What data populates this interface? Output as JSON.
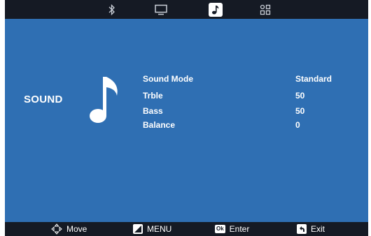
{
  "tabs": [
    {
      "icon": "bluetooth-icon",
      "active": false
    },
    {
      "icon": "monitor-icon",
      "active": false
    },
    {
      "icon": "music-note-icon",
      "active": true
    },
    {
      "icon": "apps-grid-icon",
      "active": false
    }
  ],
  "section": {
    "title": "SOUND",
    "icon": "music-note-icon"
  },
  "settings": [
    {
      "label": "Sound Mode",
      "value": "Standard"
    },
    {
      "label": "Trble",
      "value": "50"
    },
    {
      "label": "Bass",
      "value": "50"
    },
    {
      "label": "Balance",
      "value": "0"
    }
  ],
  "help": {
    "move": "Move",
    "menu": "MENU",
    "ok_key": "Ok",
    "enter": "Enter",
    "exit": "Exit"
  },
  "colors": {
    "background": "#2f6fb3",
    "bars": "#151a24",
    "text": "#ffffff"
  }
}
